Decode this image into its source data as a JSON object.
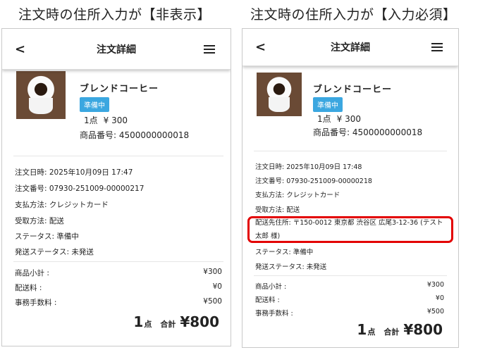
{
  "captions": {
    "left": "注文時の住所入力が【非表示】",
    "right": "注文時の住所入力が【入力必須】"
  },
  "left": {
    "header": {
      "back": "<",
      "title": "注文詳細",
      "menu_icon": "hamburger-menu-icon"
    },
    "product": {
      "name": "ブレンドコーヒー",
      "status": "準備中",
      "qty": "1点",
      "price": "¥ 300",
      "sku": "商品番号: 4500000000018"
    },
    "info": [
      "注文日時: 2025年10月09日 17:47",
      "注文番号: 07930-251009-00000217",
      "支払方法: クレジットカード",
      "受取方法: 配送",
      "ステータス: 準備中",
      "発送ステータス: 未発送"
    ],
    "fees": [
      {
        "label": "商品小計 :",
        "value": "¥300"
      },
      {
        "label": "配送料 :",
        "value": "¥0"
      },
      {
        "label": "事務手数料 :",
        "value": "¥500"
      }
    ],
    "total": {
      "count": "1",
      "unit": "点",
      "label": "合計",
      "amount": "¥800"
    }
  },
  "right": {
    "header": {
      "back": "<",
      "title": "注文詳細",
      "menu_icon": "hamburger-menu-icon"
    },
    "product": {
      "name": "ブレンドコーヒー",
      "status": "準備中",
      "qty": "1点",
      "price": "¥ 300",
      "sku": "商品番号: 4500000000018"
    },
    "info": [
      "注文日時: 2025年10月09日 17:48",
      "注文番号: 07930-251009-00000218",
      "支払方法: クレジットカード",
      "受取方法: 配送"
    ],
    "address": "配送先住所: 〒150-0012 東京都 渋谷区 広尾3-12-36 (テスト 太郎 様)",
    "info_after": [
      "ステータス: 準備中",
      "発送ステータス: 未発送"
    ],
    "fees": [
      {
        "label": "商品小計 :",
        "value": "¥300"
      },
      {
        "label": "配送料 :",
        "value": "¥0"
      },
      {
        "label": "事務手数料 :",
        "value": "¥500"
      }
    ],
    "total": {
      "count": "1",
      "unit": "点",
      "label": "合計",
      "amount": "¥800"
    }
  },
  "colors": {
    "badge": "#3ba7e0",
    "highlight": "#e30000"
  }
}
